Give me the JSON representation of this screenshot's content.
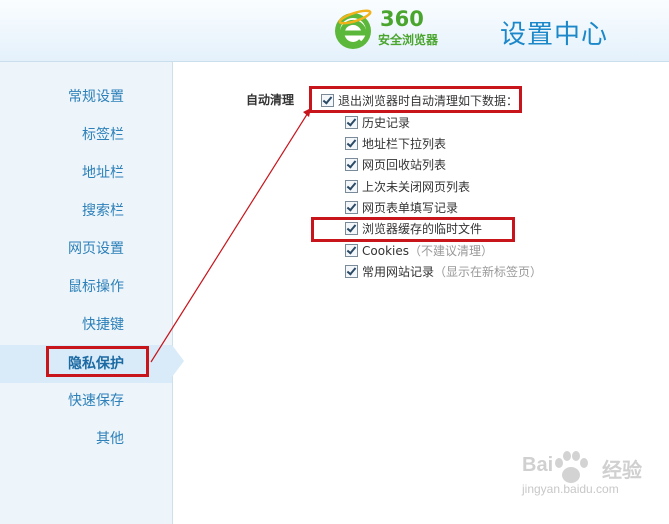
{
  "header": {
    "logo_number": "360",
    "logo_name": "安全浏览器",
    "title": "设置中心"
  },
  "sidebar": {
    "items": [
      {
        "label": "常规设置"
      },
      {
        "label": "标签栏"
      },
      {
        "label": "地址栏"
      },
      {
        "label": "搜索栏"
      },
      {
        "label": "网页设置"
      },
      {
        "label": "鼠标操作"
      },
      {
        "label": "快捷键"
      },
      {
        "label": "隐私保护",
        "active": true
      },
      {
        "label": "快速保存"
      },
      {
        "label": "其他"
      }
    ]
  },
  "content": {
    "section_label": "自动清理",
    "main_option": {
      "label": "退出浏览器时自动清理如下数据：",
      "checked": true
    },
    "options": [
      {
        "label": "历史记录",
        "checked": true
      },
      {
        "label": "地址栏下拉列表",
        "checked": true
      },
      {
        "label": "网页回收站列表",
        "checked": true
      },
      {
        "label": "上次未关闭网页列表",
        "checked": true
      },
      {
        "label": "网页表单填写记录",
        "checked": true
      },
      {
        "label": "浏览器缓存的临时文件",
        "checked": true
      },
      {
        "label": "Cookies",
        "note": "（不建议清理）",
        "checked": true
      },
      {
        "label": "常用网站记录",
        "note": "（显示在新标签页）",
        "checked": true
      }
    ]
  },
  "watermark": {
    "brand": "Bai",
    "brand_cn": "经验",
    "url": "jingyan.baidu.com"
  },
  "colors": {
    "accent": "#1d88c9",
    "logo_green": "#4aa52e",
    "annotation_red": "#c8141b"
  }
}
